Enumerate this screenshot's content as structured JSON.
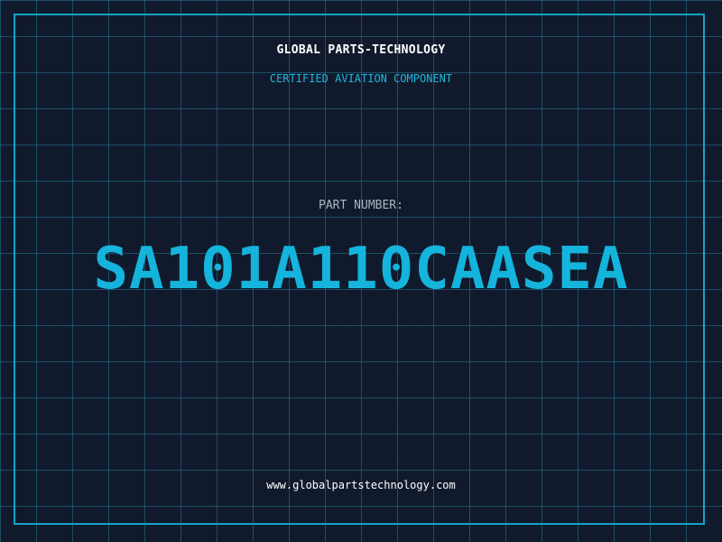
{
  "header": {
    "company": "GLOBAL PARTS-TECHNOLOGY",
    "tagline": "CERTIFIED AVIATION COMPONENT"
  },
  "part": {
    "label": "PART NUMBER:",
    "number": "SA101A110CAASEA"
  },
  "footer": {
    "website": "www.globalpartstechnology.com"
  },
  "colors": {
    "background": "#111a2c",
    "grid": "#22788f",
    "accent": "#14b4dc",
    "text": "#ffffff",
    "muted": "#aab4c2"
  }
}
